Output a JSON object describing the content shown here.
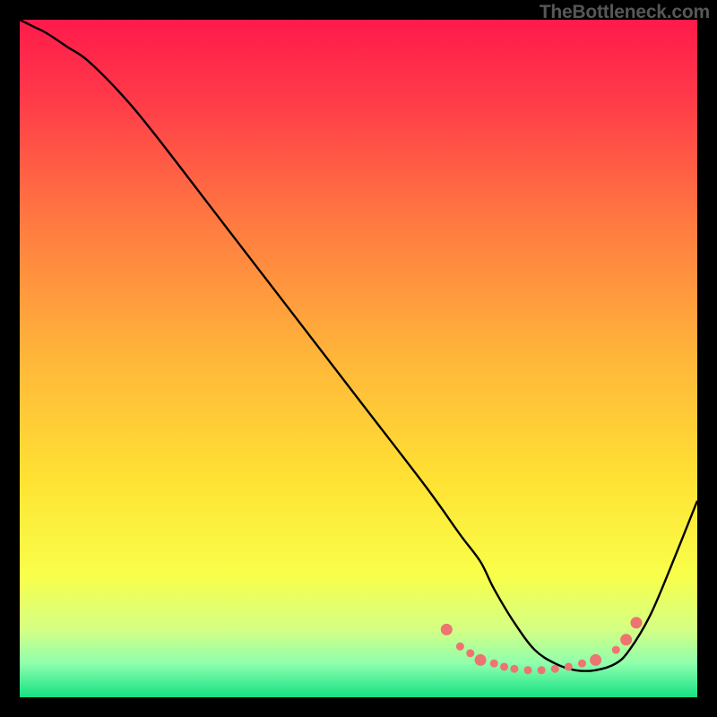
{
  "watermark": "TheBottleneck.com",
  "chart_data": {
    "type": "line",
    "title": "",
    "xlabel": "",
    "ylabel": "",
    "xlim": [
      0,
      100
    ],
    "ylim": [
      0,
      100
    ],
    "background_gradient": {
      "stops": [
        {
          "offset": 0.0,
          "color": "#ff1a4b"
        },
        {
          "offset": 0.12,
          "color": "#ff3b49"
        },
        {
          "offset": 0.3,
          "color": "#ff7a41"
        },
        {
          "offset": 0.5,
          "color": "#ffb63a"
        },
        {
          "offset": 0.68,
          "color": "#ffe233"
        },
        {
          "offset": 0.82,
          "color": "#f8ff4a"
        },
        {
          "offset": 0.9,
          "color": "#d4ff84"
        },
        {
          "offset": 0.95,
          "color": "#8fffad"
        },
        {
          "offset": 1.0,
          "color": "#14e083"
        }
      ]
    },
    "series": [
      {
        "name": "curve",
        "color": "#000000",
        "x": [
          0,
          2,
          4,
          7,
          10,
          15,
          20,
          30,
          40,
          50,
          60,
          65,
          68,
          70,
          73,
          76,
          79,
          82,
          85,
          88,
          90,
          93,
          96,
          100
        ],
        "y": [
          100,
          99,
          98,
          96,
          94,
          89,
          83,
          70,
          57,
          44,
          31,
          24,
          20,
          16,
          11,
          7,
          5,
          4,
          4,
          5,
          7,
          12,
          19,
          29
        ]
      }
    ],
    "markers": {
      "color": "#ed7470",
      "radius_small": 4.5,
      "radius_large": 6.5,
      "points": [
        {
          "x": 63,
          "y": 10,
          "r": "large"
        },
        {
          "x": 65,
          "y": 7.5,
          "r": "small"
        },
        {
          "x": 66.5,
          "y": 6.5,
          "r": "small"
        },
        {
          "x": 68,
          "y": 5.5,
          "r": "large"
        },
        {
          "x": 70,
          "y": 5,
          "r": "small"
        },
        {
          "x": 71.5,
          "y": 4.5,
          "r": "small"
        },
        {
          "x": 73,
          "y": 4.2,
          "r": "small"
        },
        {
          "x": 75,
          "y": 4,
          "r": "small"
        },
        {
          "x": 77,
          "y": 4,
          "r": "small"
        },
        {
          "x": 79,
          "y": 4.2,
          "r": "small"
        },
        {
          "x": 81,
          "y": 4.5,
          "r": "small"
        },
        {
          "x": 83,
          "y": 5,
          "r": "small"
        },
        {
          "x": 85,
          "y": 5.5,
          "r": "large"
        },
        {
          "x": 88,
          "y": 7,
          "r": "small"
        },
        {
          "x": 89.5,
          "y": 8.5,
          "r": "large"
        },
        {
          "x": 91,
          "y": 11,
          "r": "large"
        }
      ]
    }
  }
}
